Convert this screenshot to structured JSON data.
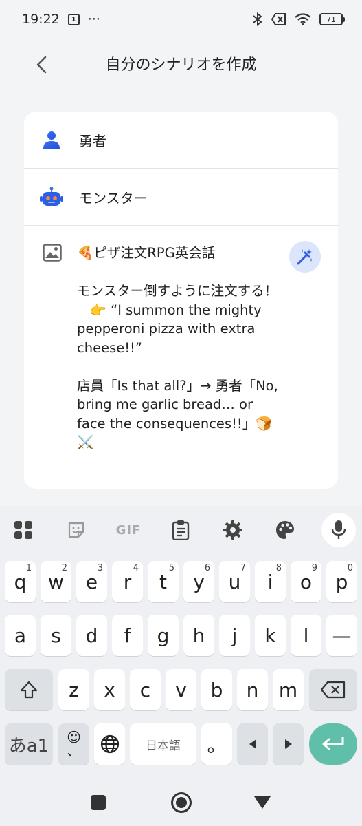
{
  "status": {
    "time": "19:22",
    "notif_box": "1",
    "dots": "···",
    "battery": "71"
  },
  "header": {
    "title": "自分のシナリオを作成"
  },
  "roles": [
    {
      "label": "勇者",
      "icon": "person-icon"
    },
    {
      "label": "モンスター",
      "icon": "robot-icon"
    }
  ],
  "scenario": {
    "text": "🍕ピザ注文RPG英会話\n\nモンスター倒すように注文する！\n   👉 “I summon the mighty pepperoni pizza with extra cheese!!”\n\n店員「Is that all?」→ 勇者「No, bring me garlic bread… or face the consequences!!」🍞⚔️",
    "icon": "image-icon",
    "action_icon": "magic-wand-icon"
  },
  "keyboard": {
    "toolbar": [
      "apps-icon",
      "sticker-icon",
      "GIF",
      "clipboard-icon",
      "settings-icon",
      "palette-icon",
      "mic-icon"
    ],
    "row1": [
      {
        "k": "q",
        "h": "1"
      },
      {
        "k": "w",
        "h": "2"
      },
      {
        "k": "e",
        "h": "3"
      },
      {
        "k": "r",
        "h": "4"
      },
      {
        "k": "t",
        "h": "5"
      },
      {
        "k": "y",
        "h": "6"
      },
      {
        "k": "u",
        "h": "7"
      },
      {
        "k": "i",
        "h": "8"
      },
      {
        "k": "o",
        "h": "9"
      },
      {
        "k": "p",
        "h": "0"
      }
    ],
    "row2": [
      "a",
      "s",
      "d",
      "f",
      "g",
      "h",
      "j",
      "k",
      "l",
      "—"
    ],
    "row3": [
      "z",
      "x",
      "c",
      "v",
      "b",
      "n",
      "m"
    ],
    "lang_key": "あa1",
    "emoji_key": "☺",
    "comma": "、",
    "space_label": "日本語",
    "period": "。",
    "accent": "#5fbfa8"
  }
}
